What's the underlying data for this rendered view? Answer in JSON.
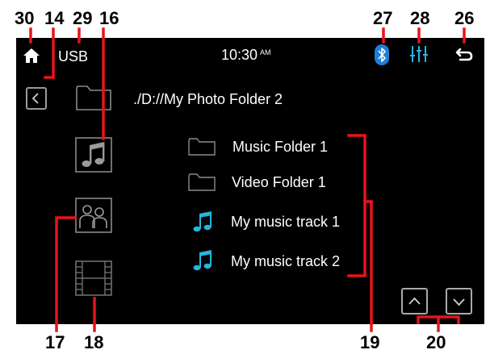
{
  "status_bar": {
    "source_label": "USB",
    "time": "10:30",
    "time_suffix": "AM"
  },
  "path": "./D://My Photo Folder 2",
  "list_items": [
    {
      "label": "Music Folder 1",
      "type": "folder"
    },
    {
      "label": "Video Folder 1",
      "type": "folder"
    },
    {
      "label": "My music track 1",
      "type": "music"
    },
    {
      "label": "My music track 2",
      "type": "music"
    }
  ],
  "callouts": {
    "c30": "30",
    "c14": "14",
    "c29": "29",
    "c16": "16",
    "c27": "27",
    "c28": "28",
    "c26": "26",
    "c17": "17",
    "c18": "18",
    "c19": "19",
    "c20": "20"
  },
  "colors": {
    "callout_line": "#e8131b",
    "music_note": "#25b6e0",
    "bluetooth": "#1e7fd8",
    "equalizer": "#25b6e0"
  },
  "icons": [
    "home-icon",
    "bluetooth-icon",
    "equalizer-icon",
    "back-arrow-icon",
    "chevron-left-icon",
    "folder-icon",
    "music-category-icon",
    "photo-category-icon",
    "video-category-icon",
    "music-note-icon",
    "chevron-up-icon",
    "chevron-down-icon"
  ]
}
